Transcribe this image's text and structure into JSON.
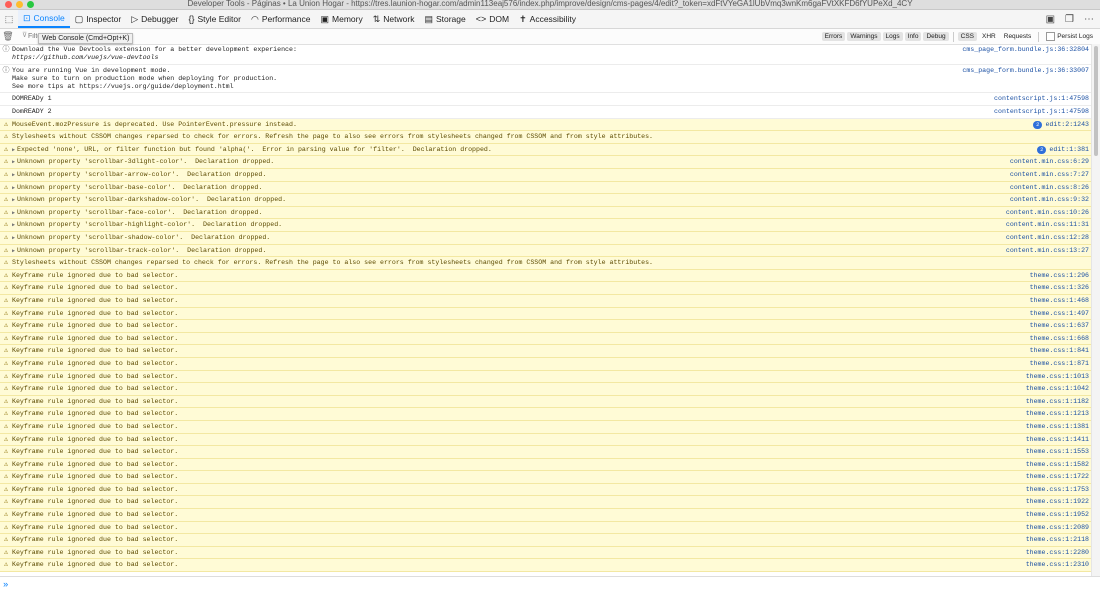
{
  "window": {
    "title": "Developer Tools - Páginas • La Union Hogar - https://tres.launion-hogar.com/admin113eaj576/index.php/improve/design/cms-pages/4/edit?_token=xdFtVYeGA1lUbVmq3wnKm6gaFVtXKFD6fYUPeXd_4CY"
  },
  "tabs": [
    {
      "label": "Console",
      "icon": "console-icon",
      "glyph": "⊡"
    },
    {
      "label": "Inspector",
      "icon": "inspector-icon",
      "glyph": "▢"
    },
    {
      "label": "Debugger",
      "icon": "debugger-icon",
      "glyph": "▷"
    },
    {
      "label": "Style Editor",
      "icon": "style-editor-icon",
      "glyph": "{}"
    },
    {
      "label": "Performance",
      "icon": "performance-icon",
      "glyph": "◠"
    },
    {
      "label": "Memory",
      "icon": "memory-icon",
      "glyph": "▣"
    },
    {
      "label": "Network",
      "icon": "network-icon",
      "glyph": "⇅"
    },
    {
      "label": "Storage",
      "icon": "storage-icon",
      "glyph": "▤"
    },
    {
      "label": "DOM",
      "icon": "dom-icon",
      "glyph": "<>"
    },
    {
      "label": "Accessibility",
      "icon": "accessibility-icon",
      "glyph": "✝"
    }
  ],
  "filter": {
    "placeholder": "Filter output",
    "tooltip": "Web Console (Cmd+Opt+K)",
    "levels": [
      "Errors",
      "Warnings",
      "Logs",
      "Info",
      "Debug"
    ],
    "extras": [
      "CSS",
      "XHR",
      "Requests"
    ],
    "persist": "Persist Logs"
  },
  "messages": [
    {
      "type": "info",
      "lines": [
        "Download the Vue Devtools extension for a better development experience:",
        "https://github.com/vuejs/vue-devtools"
      ],
      "italic_last": true,
      "source": "cms_page_form.bundle.js:36:32804"
    },
    {
      "type": "info",
      "lines": [
        "You are running Vue in development mode.",
        "Make sure to turn on production mode when deploying for production.",
        "See more tips at https://vuejs.org/guide/deployment.html"
      ],
      "source": "cms_page_form.bundle.js:36:33007"
    },
    {
      "type": "log",
      "lines": [
        "DOMREADy 1"
      ],
      "source": "contentscript.js:1:47598"
    },
    {
      "type": "log",
      "lines": [
        "DomREADY 2"
      ],
      "source": "contentscript.js:1:47598"
    },
    {
      "type": "warn",
      "lines": [
        "MouseEvent.mozPressure is deprecated. Use PointerEvent.pressure instead."
      ],
      "badge": "2",
      "source": "edit:2:1243"
    },
    {
      "type": "warn",
      "lines": [
        "Stylesheets without CSSOM changes reparsed to check for errors. Refresh the page to also see errors from stylesheets changed from CSSOM and from style attributes."
      ],
      "source": ""
    },
    {
      "type": "warn",
      "expand": true,
      "lines": [
        "Expected 'none', URL, or filter function but found 'alpha('.  Error in parsing value for 'filter'.  Declaration dropped."
      ],
      "badge": "2",
      "source": "edit:1:381"
    },
    {
      "type": "warn",
      "expand": true,
      "lines": [
        "Unknown property 'scrollbar-3dlight-color'.  Declaration dropped."
      ],
      "source": "content.min.css:6:29"
    },
    {
      "type": "warn",
      "expand": true,
      "lines": [
        "Unknown property 'scrollbar-arrow-color'.  Declaration dropped."
      ],
      "source": "content.min.css:7:27"
    },
    {
      "type": "warn",
      "expand": true,
      "lines": [
        "Unknown property 'scrollbar-base-color'.  Declaration dropped."
      ],
      "source": "content.min.css:8:26"
    },
    {
      "type": "warn",
      "expand": true,
      "lines": [
        "Unknown property 'scrollbar-darkshadow-color'.  Declaration dropped."
      ],
      "source": "content.min.css:9:32"
    },
    {
      "type": "warn",
      "expand": true,
      "lines": [
        "Unknown property 'scrollbar-face-color'.  Declaration dropped."
      ],
      "source": "content.min.css:10:26"
    },
    {
      "type": "warn",
      "expand": true,
      "lines": [
        "Unknown property 'scrollbar-highlight-color'.  Declaration dropped."
      ],
      "source": "content.min.css:11:31"
    },
    {
      "type": "warn",
      "expand": true,
      "lines": [
        "Unknown property 'scrollbar-shadow-color'.  Declaration dropped."
      ],
      "source": "content.min.css:12:28"
    },
    {
      "type": "warn",
      "expand": true,
      "lines": [
        "Unknown property 'scrollbar-track-color'.  Declaration dropped."
      ],
      "source": "content.min.css:13:27"
    },
    {
      "type": "warn",
      "lines": [
        "Stylesheets without CSSOM changes reparsed to check for errors. Refresh the page to also see errors from stylesheets changed from CSSOM and from style attributes."
      ],
      "source": ""
    },
    {
      "type": "warn",
      "lines": [
        "Keyframe rule ignored due to bad selector."
      ],
      "source": "theme.css:1:296"
    },
    {
      "type": "warn",
      "lines": [
        "Keyframe rule ignored due to bad selector."
      ],
      "source": "theme.css:1:326"
    },
    {
      "type": "warn",
      "lines": [
        "Keyframe rule ignored due to bad selector."
      ],
      "source": "theme.css:1:468"
    },
    {
      "type": "warn",
      "lines": [
        "Keyframe rule ignored due to bad selector."
      ],
      "source": "theme.css:1:497"
    },
    {
      "type": "warn",
      "lines": [
        "Keyframe rule ignored due to bad selector."
      ],
      "source": "theme.css:1:637"
    },
    {
      "type": "warn",
      "lines": [
        "Keyframe rule ignored due to bad selector."
      ],
      "source": "theme.css:1:668"
    },
    {
      "type": "warn",
      "lines": [
        "Keyframe rule ignored due to bad selector."
      ],
      "source": "theme.css:1:841"
    },
    {
      "type": "warn",
      "lines": [
        "Keyframe rule ignored due to bad selector."
      ],
      "source": "theme.css:1:871"
    },
    {
      "type": "warn",
      "lines": [
        "Keyframe rule ignored due to bad selector."
      ],
      "source": "theme.css:1:1013"
    },
    {
      "type": "warn",
      "lines": [
        "Keyframe rule ignored due to bad selector."
      ],
      "source": "theme.css:1:1042"
    },
    {
      "type": "warn",
      "lines": [
        "Keyframe rule ignored due to bad selector."
      ],
      "source": "theme.css:1:1182"
    },
    {
      "type": "warn",
      "lines": [
        "Keyframe rule ignored due to bad selector."
      ],
      "source": "theme.css:1:1213"
    },
    {
      "type": "warn",
      "lines": [
        "Keyframe rule ignored due to bad selector."
      ],
      "source": "theme.css:1:1381"
    },
    {
      "type": "warn",
      "lines": [
        "Keyframe rule ignored due to bad selector."
      ],
      "source": "theme.css:1:1411"
    },
    {
      "type": "warn",
      "lines": [
        "Keyframe rule ignored due to bad selector."
      ],
      "source": "theme.css:1:1553"
    },
    {
      "type": "warn",
      "lines": [
        "Keyframe rule ignored due to bad selector."
      ],
      "source": "theme.css:1:1582"
    },
    {
      "type": "warn",
      "lines": [
        "Keyframe rule ignored due to bad selector."
      ],
      "source": "theme.css:1:1722"
    },
    {
      "type": "warn",
      "lines": [
        "Keyframe rule ignored due to bad selector."
      ],
      "source": "theme.css:1:1753"
    },
    {
      "type": "warn",
      "lines": [
        "Keyframe rule ignored due to bad selector."
      ],
      "source": "theme.css:1:1922"
    },
    {
      "type": "warn",
      "lines": [
        "Keyframe rule ignored due to bad selector."
      ],
      "source": "theme.css:1:1952"
    },
    {
      "type": "warn",
      "lines": [
        "Keyframe rule ignored due to bad selector."
      ],
      "source": "theme.css:1:2089"
    },
    {
      "type": "warn",
      "lines": [
        "Keyframe rule ignored due to bad selector."
      ],
      "source": "theme.css:1:2118"
    },
    {
      "type": "warn",
      "lines": [
        "Keyframe rule ignored due to bad selector."
      ],
      "source": "theme.css:1:2280"
    },
    {
      "type": "warn",
      "lines": [
        "Keyframe rule ignored due to bad selector."
      ],
      "source": "theme.css:1:2310"
    }
  ],
  "input": {
    "prompt": "»"
  }
}
